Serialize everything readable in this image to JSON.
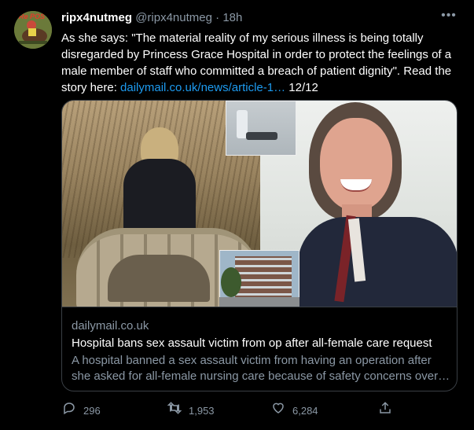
{
  "user": {
    "display_name": "ripx4nutmeg",
    "handle": "@ripx4nutmeg",
    "separator": "·",
    "time": "18h",
    "avatar_label": "Re POS"
  },
  "tweet": {
    "text_before_link": "As she says: \"The material reality of my serious illness is being totally disregarded by Princess Grace Hospital in order to protect the feelings of a male member of staff who committed a breach of patient dignity\". Read the story here: ",
    "link_text": "dailymail.co.uk/news/article-1…",
    "text_after_link": " 12/12"
  },
  "card": {
    "domain": "dailymail.co.uk",
    "title": "Hospital bans sex assault victim from op after all-female care request",
    "description": "A hospital banned a sex assault victim from having an operation after she asked for all-female nursing care because of safety concerns over…"
  },
  "actions": {
    "reply_count": "296",
    "retweet_count": "1,953",
    "like_count": "6,284"
  },
  "icons": {
    "more": "more-icon",
    "reply": "reply-icon",
    "retweet": "retweet-icon",
    "like": "heart-icon",
    "share": "share-icon"
  },
  "colors": {
    "background": "#000000",
    "link": "#1d9bf0",
    "secondary_text": "#8b98a5",
    "primary_text": "#ffffff",
    "border": "#3a3f45"
  }
}
